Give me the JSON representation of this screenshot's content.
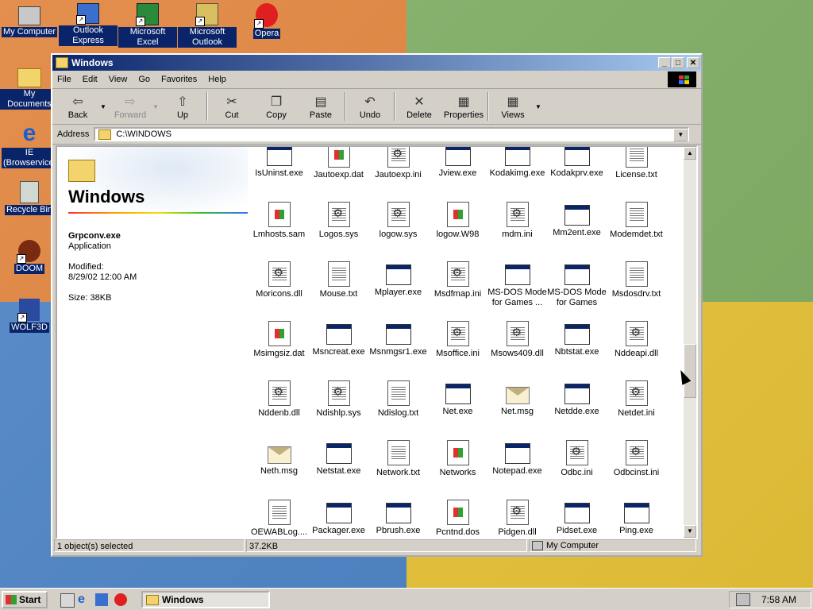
{
  "desktop": {
    "icons": [
      {
        "label": "My Computer",
        "icon": "computer-icon"
      },
      {
        "label": "Outlook Express",
        "icon": "outlook-express-icon"
      },
      {
        "label": "Microsoft Excel",
        "icon": "excel-icon"
      },
      {
        "label": "Microsoft Outlook",
        "icon": "outlook-icon"
      },
      {
        "label": "Opera",
        "icon": "opera-icon"
      },
      {
        "label": "My Documents",
        "icon": "my-documents-icon"
      },
      {
        "label": "IE (Browservice)",
        "icon": "ie-icon"
      },
      {
        "label": "Recycle Bin",
        "icon": "recycle-bin-icon"
      },
      {
        "label": "DOOM",
        "icon": "doom-icon"
      },
      {
        "label": "WOLF3D",
        "icon": "wolf3d-icon"
      }
    ]
  },
  "window": {
    "title": "Windows",
    "menu": [
      "File",
      "Edit",
      "View",
      "Go",
      "Favorites",
      "Help"
    ],
    "toolbar": [
      {
        "label": "Back",
        "icon": "back-arrow-icon"
      },
      {
        "label": "Forward",
        "icon": "forward-arrow-icon"
      },
      {
        "label": "Up",
        "icon": "up-folder-icon"
      },
      {
        "label": "Cut",
        "icon": "scissors-icon"
      },
      {
        "label": "Copy",
        "icon": "copy-icon"
      },
      {
        "label": "Paste",
        "icon": "paste-icon"
      },
      {
        "label": "Undo",
        "icon": "undo-icon"
      },
      {
        "label": "Delete",
        "icon": "delete-x-icon"
      },
      {
        "label": "Properties",
        "icon": "properties-icon"
      },
      {
        "label": "Views",
        "icon": "views-icon"
      }
    ],
    "address_label": "Address",
    "address_value": "C:\\WINDOWS",
    "left_pane": {
      "title": "Windows",
      "selected_name": "Grpconv.exe",
      "selected_type": "Application",
      "modified_label": "Modified:",
      "modified_value": "8/29/02 12:00 AM",
      "size": "Size: 38KB"
    },
    "files": [
      {
        "name": "IsUninst.exe",
        "icon": "app"
      },
      {
        "name": "Jautoexp.dat",
        "icon": "win"
      },
      {
        "name": "Jautoexp.ini",
        "icon": "cfg"
      },
      {
        "name": "Jview.exe",
        "icon": "app"
      },
      {
        "name": "Kodakimg.exe",
        "icon": "app"
      },
      {
        "name": "Kodakprv.exe",
        "icon": "app"
      },
      {
        "name": "License.txt",
        "icon": "doc"
      },
      {
        "name": "Lmhosts.sam",
        "icon": "win"
      },
      {
        "name": "Logos.sys",
        "icon": "cfg"
      },
      {
        "name": "logow.sys",
        "icon": "cfg"
      },
      {
        "name": "logow.W98",
        "icon": "win"
      },
      {
        "name": "mdm.ini",
        "icon": "cfg"
      },
      {
        "name": "Mm2ent.exe",
        "icon": "app"
      },
      {
        "name": "Modemdet.txt",
        "icon": "doc"
      },
      {
        "name": "Moricons.dll",
        "icon": "cfg"
      },
      {
        "name": "Mouse.txt",
        "icon": "doc"
      },
      {
        "name": "Mplayer.exe",
        "icon": "app"
      },
      {
        "name": "Msdfmap.ini",
        "icon": "cfg"
      },
      {
        "name": "MS-DOS Mode for Games ...",
        "icon": "app"
      },
      {
        "name": "MS-DOS Mode for Games",
        "icon": "app"
      },
      {
        "name": "Msdosdrv.txt",
        "icon": "doc"
      },
      {
        "name": "Msimgsiz.dat",
        "icon": "win"
      },
      {
        "name": "Msncreat.exe",
        "icon": "app"
      },
      {
        "name": "Msnmgsr1.exe",
        "icon": "app"
      },
      {
        "name": "Msoffice.ini",
        "icon": "cfg"
      },
      {
        "name": "Msows409.dll",
        "icon": "cfg"
      },
      {
        "name": "Nbtstat.exe",
        "icon": "app"
      },
      {
        "name": "Nddeapi.dll",
        "icon": "cfg"
      },
      {
        "name": "Nddenb.dll",
        "icon": "cfg"
      },
      {
        "name": "Ndishlp.sys",
        "icon": "cfg"
      },
      {
        "name": "Ndislog.txt",
        "icon": "doc"
      },
      {
        "name": "Net.exe",
        "icon": "app"
      },
      {
        "name": "Net.msg",
        "icon": "msg"
      },
      {
        "name": "Netdde.exe",
        "icon": "app"
      },
      {
        "name": "Netdet.ini",
        "icon": "cfg"
      },
      {
        "name": "Neth.msg",
        "icon": "msg"
      },
      {
        "name": "Netstat.exe",
        "icon": "app"
      },
      {
        "name": "Network.txt",
        "icon": "doc"
      },
      {
        "name": "Networks",
        "icon": "win"
      },
      {
        "name": "Notepad.exe",
        "icon": "app"
      },
      {
        "name": "Odbc.ini",
        "icon": "cfg"
      },
      {
        "name": "Odbcinst.ini",
        "icon": "cfg"
      },
      {
        "name": "OEWABLog....",
        "icon": "doc"
      },
      {
        "name": "Packager.exe",
        "icon": "app"
      },
      {
        "name": "Pbrush.exe",
        "icon": "app"
      },
      {
        "name": "Pcntnd.dos",
        "icon": "win"
      },
      {
        "name": "Pidgen.dll",
        "icon": "cfg"
      },
      {
        "name": "Pidset.exe",
        "icon": "app"
      },
      {
        "name": "Ping.exe",
        "icon": "app"
      }
    ],
    "status": {
      "selected": "1 object(s) selected",
      "size": "37.2KB",
      "location": "My Computer"
    }
  },
  "taskbar": {
    "start_label": "Start",
    "task_label": "Windows",
    "clock": "7:58 AM"
  },
  "colors": {
    "title_active": "#0a246a",
    "face": "#d4d0c8"
  }
}
